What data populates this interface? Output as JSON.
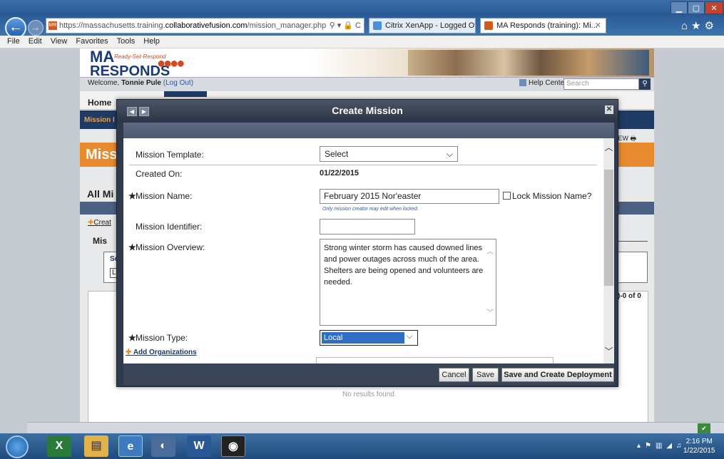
{
  "browser": {
    "url_prefix": "https://massachusetts.training.",
    "url_domain": "collaborativefusion.com",
    "url_path": "/mission_manager.php",
    "address_controls": "⚲ ▾ 🔒 C",
    "tab_inactive": "Citrix XenApp - Logged Off",
    "tab_active": "MA Responds (training): Mi...",
    "menu": [
      "File",
      "Edit",
      "View",
      "Favorites",
      "Tools",
      "Help"
    ]
  },
  "site": {
    "logo_ma": "MA",
    "logo_tagline": "Ready-Set-Respond",
    "logo_responds": "RESPONDS",
    "welcome_prefix": "Welcome,",
    "user_name": "Tonnie Pule",
    "logout": "(Log Out)",
    "help_center": "Help Center",
    "search_placeholder": "Search",
    "nav_home": "Home",
    "subnav_label": "Mission I",
    "print_label": "IEW",
    "page_title": "Miss",
    "all_missions": "All Mi",
    "create_link": "Creat",
    "mis_label": "Mis",
    "panel_s": "Sc",
    "panel_l": "L",
    "pager": ")-0 of 0",
    "no_results": "No results found."
  },
  "modal": {
    "title": "Create Mission",
    "template_label": "Mission Template:",
    "template_value": "Select",
    "created_label": "Created On:",
    "created_value": "01/22/2015",
    "name_label": "Mission Name:",
    "name_value": "February 2015 Nor'easter",
    "lock_label": "Lock Mission Name?",
    "lock_hint": "Only mission creator may edit when locked.",
    "identifier_label": "Mission Identifier:",
    "identifier_value": "",
    "overview_label": "Mission Overview:",
    "overview_value": "Strong winter storm has caused downed lines and power outages across much of the area.  Shelters are being opened and volunteers are needed.",
    "type_label": "Mission Type:",
    "type_value": "Local",
    "add_orgs": "Add Organizations",
    "required_mark": "★",
    "cancel": "Cancel",
    "save": "Save",
    "save_deploy": "Save and Create Deployment"
  },
  "taskbar": {
    "time": "2:16 PM",
    "date": "1/22/2015"
  }
}
